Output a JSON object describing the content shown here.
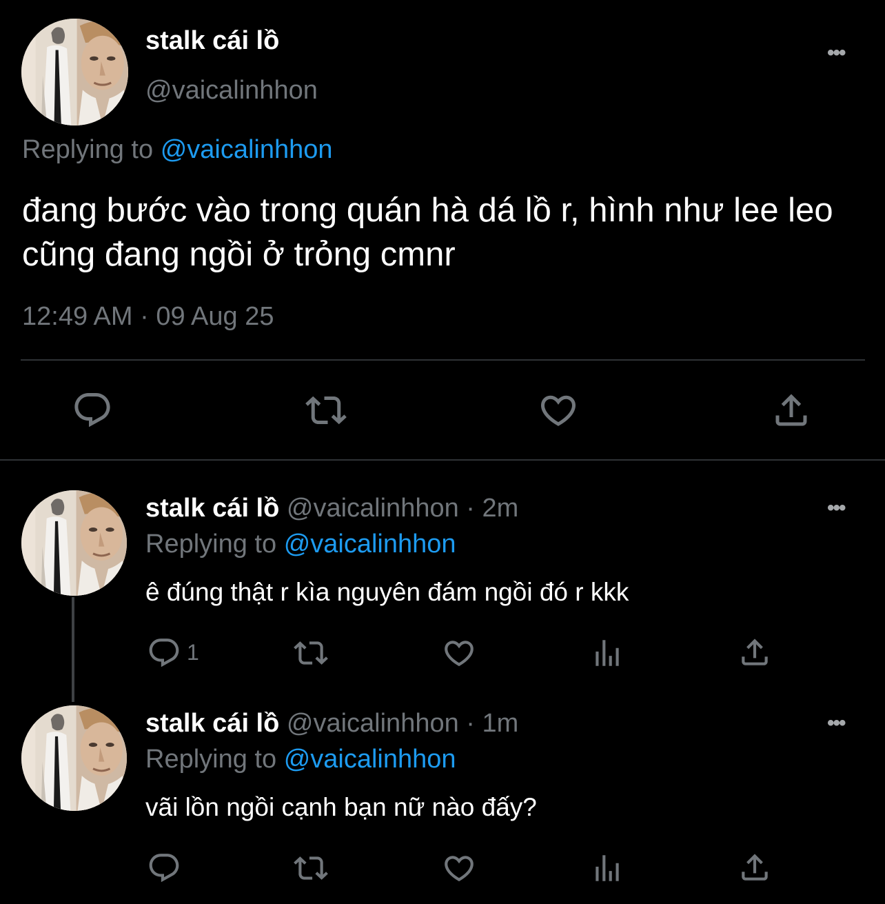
{
  "tweet": {
    "author_name": "stalk cái lồ",
    "author_handle": "@vaicalinhhon",
    "more_label": "•••",
    "replying_prefix": "Replying to",
    "replying_handle": "@vaicalinhhon",
    "text": "đang bước vào trong quán hà dá lồ r, hình như lee leo cũng đang ngồi ở trỏng cmnr",
    "timestamp": "12:49 AM · 09 Aug 25",
    "actions": [
      "reply-icon",
      "retweet-icon",
      "like-icon",
      "share-icon"
    ]
  },
  "replies": [
    {
      "author_name": "stalk cái lồ",
      "author_handle": "@vaicalinhhon",
      "time": "· 2m",
      "more_label": "•••",
      "replying_prefix": "Replying to",
      "replying_handle": "@vaicalinhhon",
      "text": "ê đúng thật r kìa nguyên đám ngồi đó r kkk",
      "reply_count": "1",
      "actions": [
        "reply-icon",
        "retweet-icon",
        "like-icon",
        "views-icon",
        "share-icon"
      ]
    },
    {
      "author_name": "stalk cái lồ",
      "author_handle": "@vaicalinhhon",
      "time": "· 1m",
      "more_label": "•••",
      "replying_prefix": "Replying to",
      "replying_handle": "@vaicalinhhon",
      "text": "vãi lồn ngồi cạnh bạn nữ nào đấy?",
      "reply_count": "",
      "actions": [
        "reply-icon",
        "retweet-icon",
        "like-icon",
        "views-icon",
        "share-icon"
      ]
    }
  ],
  "colors": {
    "background": "#000000",
    "text_primary": "#ffffff",
    "text_secondary": "#71767b",
    "link": "#1d9bf0",
    "divider": "#2f3336"
  }
}
